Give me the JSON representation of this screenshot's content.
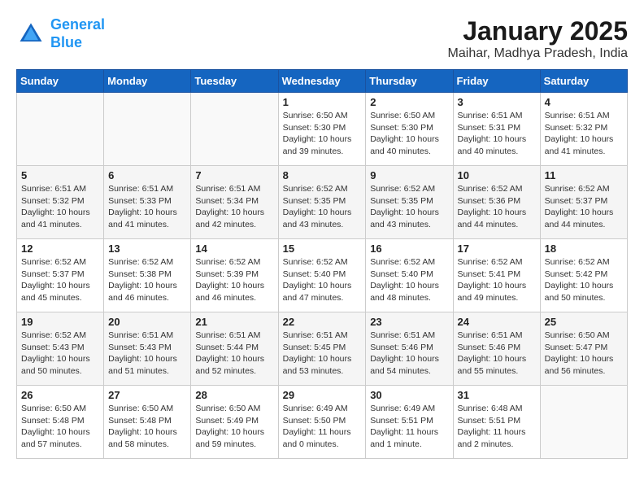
{
  "header": {
    "logo_line1": "General",
    "logo_line2": "Blue",
    "month_year": "January 2025",
    "location": "Maihar, Madhya Pradesh, India"
  },
  "weekdays": [
    "Sunday",
    "Monday",
    "Tuesday",
    "Wednesday",
    "Thursday",
    "Friday",
    "Saturday"
  ],
  "weeks": [
    [
      {
        "day": "",
        "text": ""
      },
      {
        "day": "",
        "text": ""
      },
      {
        "day": "",
        "text": ""
      },
      {
        "day": "1",
        "text": "Sunrise: 6:50 AM\nSunset: 5:30 PM\nDaylight: 10 hours\nand 39 minutes."
      },
      {
        "day": "2",
        "text": "Sunrise: 6:50 AM\nSunset: 5:30 PM\nDaylight: 10 hours\nand 40 minutes."
      },
      {
        "day": "3",
        "text": "Sunrise: 6:51 AM\nSunset: 5:31 PM\nDaylight: 10 hours\nand 40 minutes."
      },
      {
        "day": "4",
        "text": "Sunrise: 6:51 AM\nSunset: 5:32 PM\nDaylight: 10 hours\nand 41 minutes."
      }
    ],
    [
      {
        "day": "5",
        "text": "Sunrise: 6:51 AM\nSunset: 5:32 PM\nDaylight: 10 hours\nand 41 minutes."
      },
      {
        "day": "6",
        "text": "Sunrise: 6:51 AM\nSunset: 5:33 PM\nDaylight: 10 hours\nand 41 minutes."
      },
      {
        "day": "7",
        "text": "Sunrise: 6:51 AM\nSunset: 5:34 PM\nDaylight: 10 hours\nand 42 minutes."
      },
      {
        "day": "8",
        "text": "Sunrise: 6:52 AM\nSunset: 5:35 PM\nDaylight: 10 hours\nand 43 minutes."
      },
      {
        "day": "9",
        "text": "Sunrise: 6:52 AM\nSunset: 5:35 PM\nDaylight: 10 hours\nand 43 minutes."
      },
      {
        "day": "10",
        "text": "Sunrise: 6:52 AM\nSunset: 5:36 PM\nDaylight: 10 hours\nand 44 minutes."
      },
      {
        "day": "11",
        "text": "Sunrise: 6:52 AM\nSunset: 5:37 PM\nDaylight: 10 hours\nand 44 minutes."
      }
    ],
    [
      {
        "day": "12",
        "text": "Sunrise: 6:52 AM\nSunset: 5:37 PM\nDaylight: 10 hours\nand 45 minutes."
      },
      {
        "day": "13",
        "text": "Sunrise: 6:52 AM\nSunset: 5:38 PM\nDaylight: 10 hours\nand 46 minutes."
      },
      {
        "day": "14",
        "text": "Sunrise: 6:52 AM\nSunset: 5:39 PM\nDaylight: 10 hours\nand 46 minutes."
      },
      {
        "day": "15",
        "text": "Sunrise: 6:52 AM\nSunset: 5:40 PM\nDaylight: 10 hours\nand 47 minutes."
      },
      {
        "day": "16",
        "text": "Sunrise: 6:52 AM\nSunset: 5:40 PM\nDaylight: 10 hours\nand 48 minutes."
      },
      {
        "day": "17",
        "text": "Sunrise: 6:52 AM\nSunset: 5:41 PM\nDaylight: 10 hours\nand 49 minutes."
      },
      {
        "day": "18",
        "text": "Sunrise: 6:52 AM\nSunset: 5:42 PM\nDaylight: 10 hours\nand 50 minutes."
      }
    ],
    [
      {
        "day": "19",
        "text": "Sunrise: 6:52 AM\nSunset: 5:43 PM\nDaylight: 10 hours\nand 50 minutes."
      },
      {
        "day": "20",
        "text": "Sunrise: 6:51 AM\nSunset: 5:43 PM\nDaylight: 10 hours\nand 51 minutes."
      },
      {
        "day": "21",
        "text": "Sunrise: 6:51 AM\nSunset: 5:44 PM\nDaylight: 10 hours\nand 52 minutes."
      },
      {
        "day": "22",
        "text": "Sunrise: 6:51 AM\nSunset: 5:45 PM\nDaylight: 10 hours\nand 53 minutes."
      },
      {
        "day": "23",
        "text": "Sunrise: 6:51 AM\nSunset: 5:46 PM\nDaylight: 10 hours\nand 54 minutes."
      },
      {
        "day": "24",
        "text": "Sunrise: 6:51 AM\nSunset: 5:46 PM\nDaylight: 10 hours\nand 55 minutes."
      },
      {
        "day": "25",
        "text": "Sunrise: 6:50 AM\nSunset: 5:47 PM\nDaylight: 10 hours\nand 56 minutes."
      }
    ],
    [
      {
        "day": "26",
        "text": "Sunrise: 6:50 AM\nSunset: 5:48 PM\nDaylight: 10 hours\nand 57 minutes."
      },
      {
        "day": "27",
        "text": "Sunrise: 6:50 AM\nSunset: 5:48 PM\nDaylight: 10 hours\nand 58 minutes."
      },
      {
        "day": "28",
        "text": "Sunrise: 6:50 AM\nSunset: 5:49 PM\nDaylight: 10 hours\nand 59 minutes."
      },
      {
        "day": "29",
        "text": "Sunrise: 6:49 AM\nSunset: 5:50 PM\nDaylight: 11 hours\nand 0 minutes."
      },
      {
        "day": "30",
        "text": "Sunrise: 6:49 AM\nSunset: 5:51 PM\nDaylight: 11 hours\nand 1 minute."
      },
      {
        "day": "31",
        "text": "Sunrise: 6:48 AM\nSunset: 5:51 PM\nDaylight: 11 hours\nand 2 minutes."
      },
      {
        "day": "",
        "text": ""
      }
    ]
  ]
}
